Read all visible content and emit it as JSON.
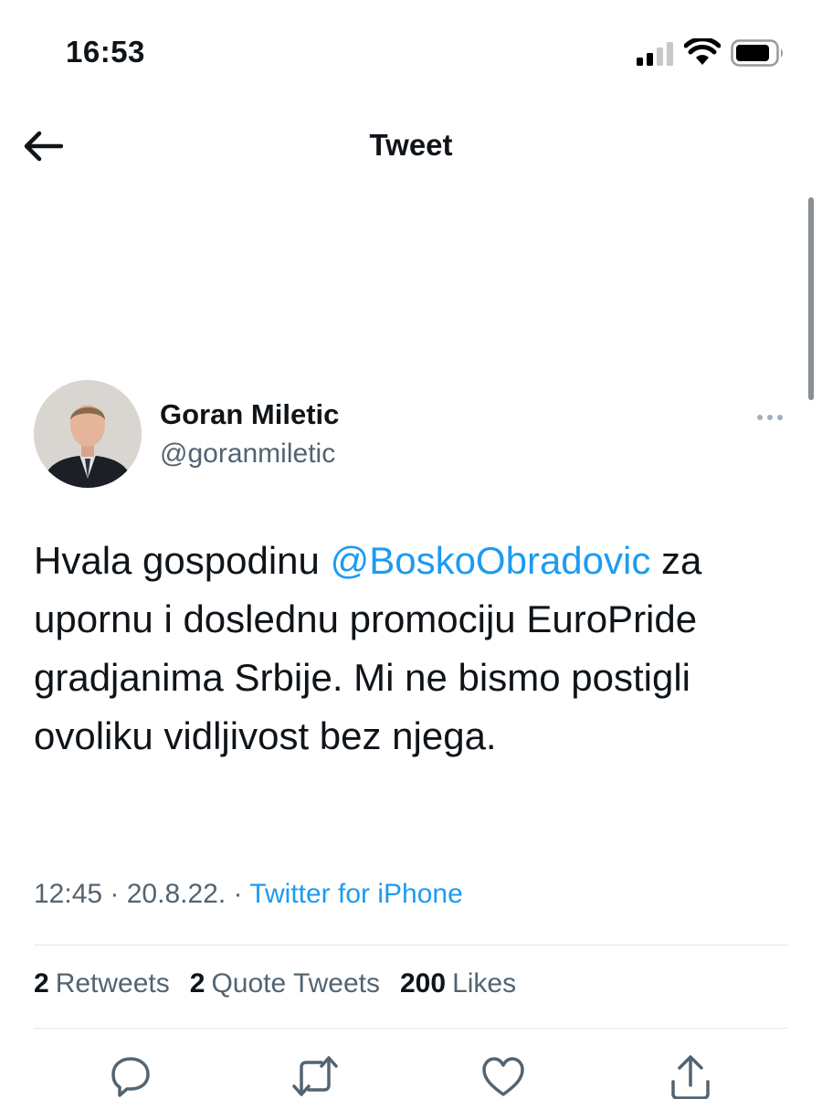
{
  "status_bar": {
    "time": "16:53",
    "icons": [
      "signal-icon",
      "wifi-icon",
      "battery-icon"
    ]
  },
  "nav": {
    "back_icon": "back-arrow-icon",
    "title": "Tweet"
  },
  "tweet": {
    "author_name": "Goran Miletic",
    "author_handle": "@goranmiletic",
    "text_prefix": "Hvala gospodinu ",
    "mention": "@BoskoObradovic",
    "text_suffix": " za upornu i doslednu promociju EuroPride gradjanima Srbije. Mi ne bismo postigli ovoliku vidljivost bez njega.",
    "time": "12:45",
    "separator": " · ",
    "date": "20.8.22.",
    "source": "Twitter for iPhone"
  },
  "stats": {
    "retweets_count": "2",
    "retweets_label": "Retweets",
    "quotes_count": "2",
    "quotes_label": "Quote Tweets",
    "likes_count": "200",
    "likes_label": "Likes"
  },
  "actions": [
    "reply-icon",
    "retweet-icon",
    "like-icon",
    "share-icon"
  ],
  "colors": {
    "accent": "#1d9bf0",
    "text": "#0f1419",
    "secondary": "#536471"
  }
}
